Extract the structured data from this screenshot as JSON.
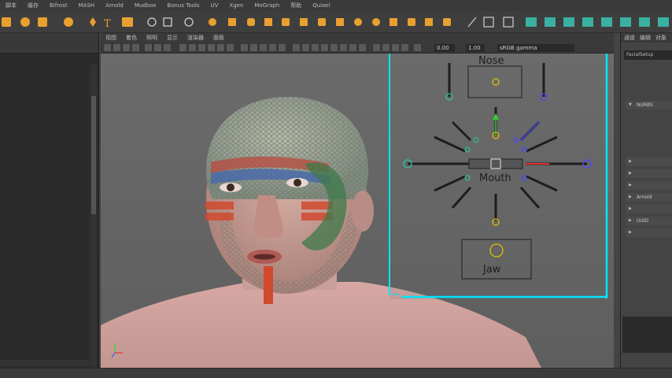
{
  "menu": {
    "items": [
      "脚本",
      "缓存",
      "Bifrost",
      "MASH",
      "Arnold",
      "Mudbox",
      "Bonus Tools",
      "UV",
      "Xgen",
      "MoGraph",
      "帮助",
      "Quixel"
    ]
  },
  "viewport_menu": {
    "items": [
      "视图",
      "着色",
      "照明",
      "显示",
      "渲染器",
      "面板"
    ]
  },
  "viewport_toolbar": {
    "field_a": "0.00",
    "field_b": "1.00",
    "color_space": "sRGB gamma"
  },
  "outliner": {
    "rows": [
      {
        "label": "",
        "selected": false
      },
      {
        "label": "",
        "selected": false
      },
      {
        "label": "",
        "selected": false
      },
      {
        "label": "",
        "selected": false
      },
      {
        "label": "",
        "selected": false
      },
      {
        "label": "",
        "selected": false
      },
      {
        "label": "",
        "selected": false
      },
      {
        "label": "",
        "selected": false
      },
      {
        "label": "",
        "selected": false
      },
      {
        "label": "",
        "selected": false
      },
      {
        "label": "",
        "selected": false
      },
      {
        "label": "",
        "selected": false
      },
      {
        "label": "",
        "selected": false
      },
      {
        "label": "",
        "selected": false
      },
      {
        "label": "",
        "selected": false
      },
      {
        "label": "",
        "selected": false
      }
    ]
  },
  "face_ui": {
    "nose_label": "Nose",
    "mouth_label": "Mouth",
    "jaw_label": "Jaw"
  },
  "right_panel": {
    "tabs": [
      "通道",
      "编辑",
      "对象"
    ],
    "node_field": "FacialSetup",
    "sections": [
      {
        "label": "NURBS",
        "open": true
      },
      {
        "label": "",
        "open": false
      },
      {
        "label": "",
        "open": false
      },
      {
        "label": "",
        "open": false
      },
      {
        "label": "Arnold",
        "open": false
      },
      {
        "label": "",
        "open": false
      },
      {
        "label": "UUID",
        "open": false
      },
      {
        "label": "",
        "open": false
      }
    ],
    "note": "",
    "bottom_label": ""
  },
  "timeline": {
    "ticks": [
      "",
      "",
      "",
      "",
      "",
      "",
      "",
      "",
      "",
      "",
      "",
      "",
      "",
      "",
      "",
      "",
      "",
      "",
      "",
      ""
    ]
  },
  "colors": {
    "selection_cyan": "#00e5ff",
    "ctrl_yellow": "#e0c000",
    "ctrl_blue": "#4a4aff",
    "ctrl_red": "#e03030",
    "ctrl_green": "#30d030",
    "maya_orange": "#e8a030",
    "maya_teal": "#3ab0a0"
  }
}
